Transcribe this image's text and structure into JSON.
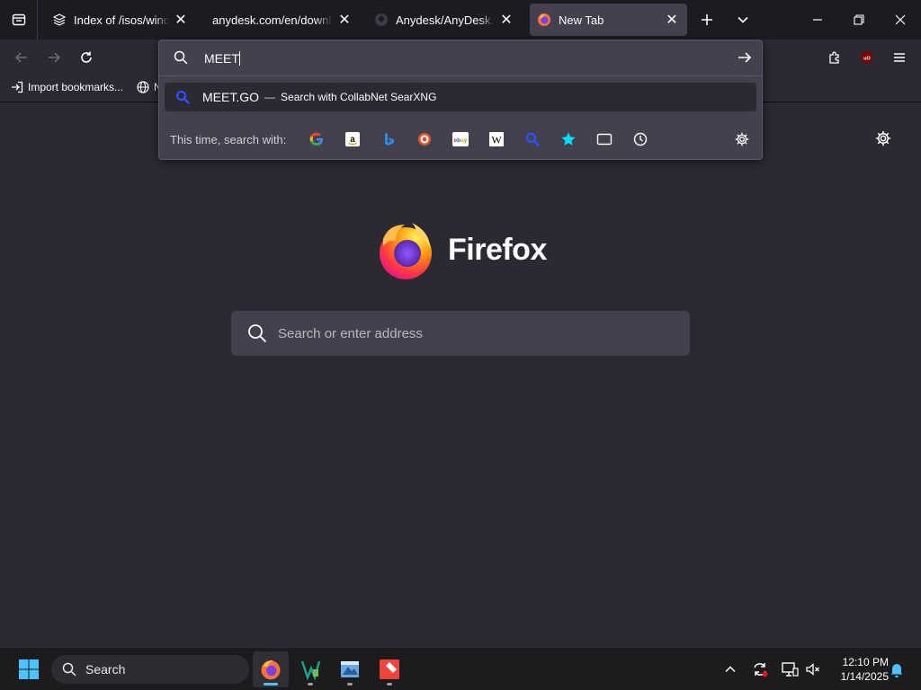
{
  "browser": {
    "tabs": [
      {
        "title": "Index of /isos/windows",
        "icon": "directory-icon",
        "selected": false
      },
      {
        "title": "anydesk.com/en/downloads",
        "icon": "",
        "selected": false
      },
      {
        "title": "Anydesk/AnyDesk.exe",
        "icon": "github-icon",
        "selected": false
      },
      {
        "title": "New Tab",
        "icon": "firefox-icon",
        "selected": true
      }
    ]
  },
  "bookmarks": [
    {
      "label": "Import bookmarks...",
      "icon": "import-icon"
    },
    {
      "label": "N",
      "icon": "globe-icon"
    }
  ],
  "urlbar": {
    "value": "MEET",
    "suggestion": {
      "title": "MEET.GO",
      "dash": "—",
      "action": "Search with CollabNet SearXNG"
    },
    "one_off_label": "This time, search with:",
    "engines": [
      "google-icon",
      "amazon-icon",
      "bing-icon",
      "duckduckgo-icon",
      "ebay-icon",
      "wikipedia-icon",
      "searxng-icon",
      "bookmarks-icon",
      "tabs-icon",
      "history-icon"
    ]
  },
  "newtab": {
    "wordmark": "Firefox",
    "search_placeholder": "Search or enter address"
  },
  "taskbar": {
    "search_label": "Search",
    "time": "12:10 PM",
    "date": "1/14/2025"
  },
  "colors": {
    "accent": "#00ddff",
    "tab_bg": "#1c1b22",
    "toolbar_bg": "#2b2a33",
    "panel_bg": "#42414d"
  }
}
